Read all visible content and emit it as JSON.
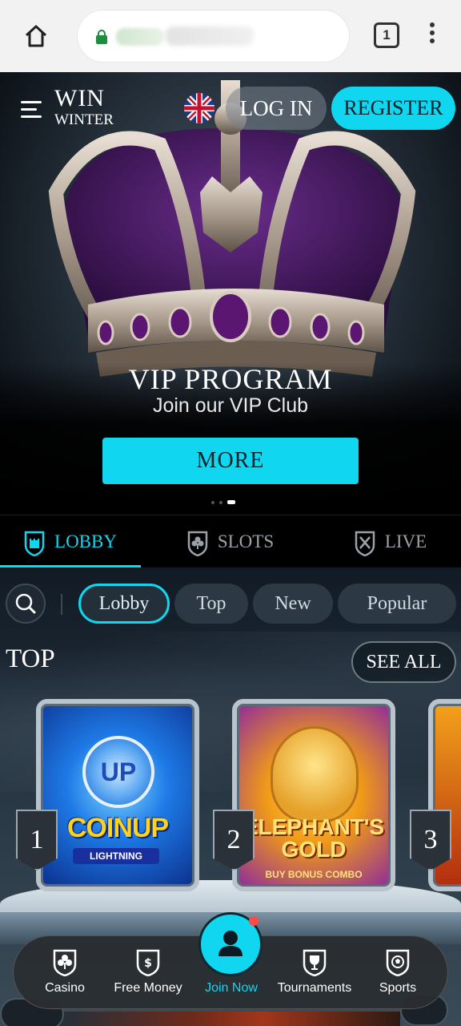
{
  "browser": {
    "tab_count": "1"
  },
  "header": {
    "logo_line1": "WIN",
    "logo_line2": "WINTER",
    "login_label": "LOG IN",
    "register_label": "REGISTER",
    "language": "English (UK flag)"
  },
  "hero": {
    "title": "VIP PROGRAM",
    "subtitle": "Join our VIP Club",
    "cta_label": "MORE",
    "slide_count": 3,
    "active_slide": 3
  },
  "category_tabs": [
    {
      "label": "LOBBY",
      "icon": "castle-shield-icon",
      "active": true
    },
    {
      "label": "SLOTS",
      "icon": "clover-shield-icon",
      "active": false
    },
    {
      "label": "LIVE",
      "icon": "crossed-swords-shield-icon",
      "active": false
    }
  ],
  "filters": {
    "chips": [
      {
        "label": "Lobby",
        "active": true
      },
      {
        "label": "Top",
        "active": false
      },
      {
        "label": "New",
        "active": false
      },
      {
        "label": "Popular",
        "active": false
      }
    ]
  },
  "section": {
    "title": "TOP",
    "see_all_label": "SEE ALL"
  },
  "games": [
    {
      "rank": "1",
      "title": "COINUP",
      "coin_text": "UP",
      "subtitle": "LIGHTNING"
    },
    {
      "rank": "2",
      "title": "ELEPHANT'S GOLD",
      "subtitle": "BUY BONUS COMBO"
    },
    {
      "rank": "3"
    }
  ],
  "bottom_nav": [
    {
      "label": "Casino",
      "icon": "clover-shield-icon"
    },
    {
      "label": "Free Money",
      "icon": "money-bag-shield-icon"
    },
    {
      "label": "Join Now",
      "icon": "user-icon"
    },
    {
      "label": "Tournaments",
      "icon": "trophy-shield-icon"
    },
    {
      "label": "Sports",
      "icon": "soccer-ball-shield-icon"
    }
  ],
  "colors": {
    "accent": "#11d6ef",
    "notification": "#ff4a4a",
    "chrome_bg": "#f2f2f2"
  }
}
